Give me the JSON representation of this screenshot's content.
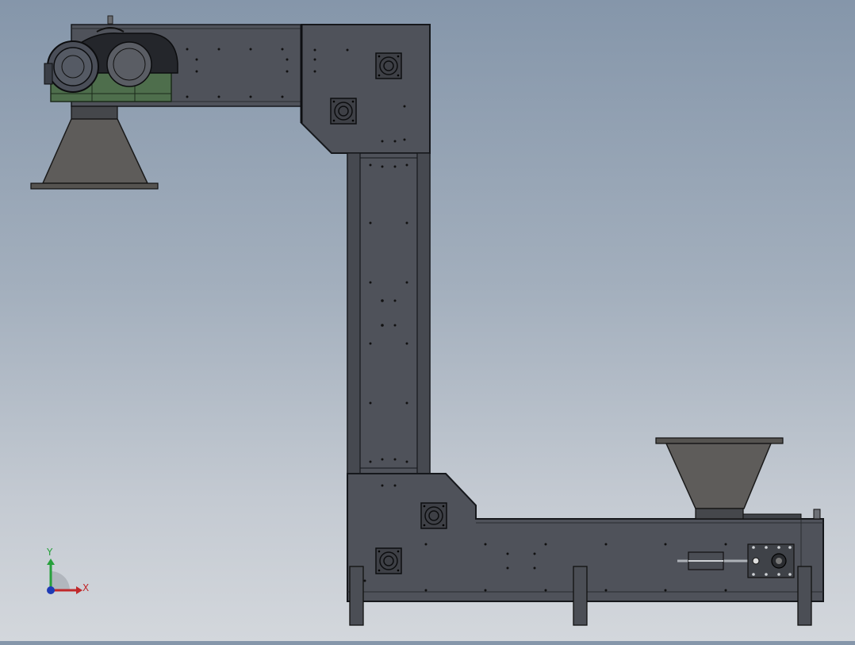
{
  "viewport": {
    "background_top": "#8596aa",
    "background_bottom": "#d3d7dc"
  },
  "model": {
    "body_color": "#4f525a",
    "edge_color": "#16181c",
    "hopper_color": "#5e5c5a",
    "gearbox_color": "#4e6e4c",
    "motor_color": "#4a4e58"
  },
  "triad": {
    "x_label": "X",
    "y_label": "Y",
    "x_color": "#c0282a",
    "y_color": "#27a03c",
    "z_color": "#1f3bb5"
  },
  "icons": {
    "coordinate_triad": "coordinate-triad-icon"
  }
}
